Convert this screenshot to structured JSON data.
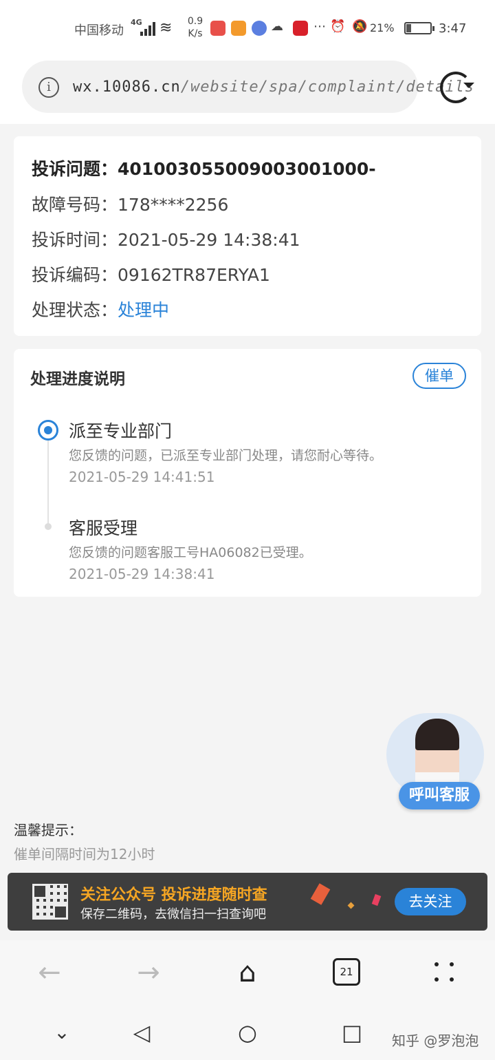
{
  "status_bar": {
    "carrier": "中国移动",
    "network": "4G",
    "speed_value": "0.9",
    "speed_unit": "K/s",
    "battery_percent": "21%",
    "battery_level": 0.21,
    "time": "3:47"
  },
  "browser": {
    "url_domain": "wx.10086.cn",
    "url_path": "/website/spa/complaint/details",
    "tab_count": "21"
  },
  "complaint": {
    "issue_label": "投诉问题：",
    "issue_value": "40100305500900300100​0-",
    "fault_label": "故障号码：",
    "fault_value": "178****2256",
    "time_label": "投诉时间：",
    "time_value": "2021-05-29 14:38:41",
    "code_label": "投诉编码：",
    "code_value": "09162TR87ERYA1",
    "status_label": "处理状态：",
    "status_value": "处理中"
  },
  "progress": {
    "title": "处理进度说明",
    "urge_button": "催单",
    "steps": [
      {
        "title": "派至专业部门",
        "desc": "您反馈的问题，已派至专业部门处理，请您耐心等待。",
        "time": "2021-05-29 14:41:51"
      },
      {
        "title": "客服受理",
        "desc": "您反馈的问题客服工号HA06082已受理。",
        "time": "2021-05-29 14:38:41"
      }
    ]
  },
  "service": {
    "label": "呼叫客服"
  },
  "tips": {
    "title": "温馨提示：",
    "text": "催单间隔时间为12小时"
  },
  "banner": {
    "title": "关注公众号 投诉进度随时查",
    "subtitle": "保存二维码，去微信扫一扫查询吧",
    "button": "去关注"
  },
  "watermark": "知乎 @罗泡泡",
  "colors": {
    "accent": "#2a83d8",
    "banner_title": "#f6a623"
  }
}
